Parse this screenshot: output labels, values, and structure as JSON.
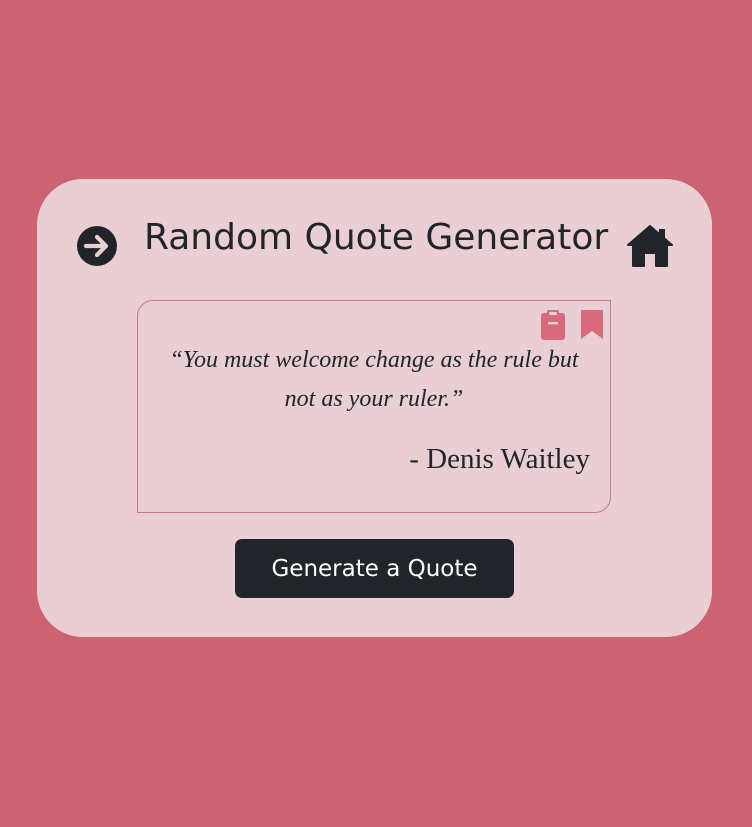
{
  "header": {
    "title": "Random Quote Generator",
    "left_icon": "arrow-right-circle-icon",
    "right_icon": "home-icon"
  },
  "quote": {
    "text": "“You must welcome change as the rule but not as your ruler.”",
    "author": "- Denis Waitley",
    "copy_icon": "clipboard-icon",
    "save_icon": "bookmark-icon"
  },
  "actions": {
    "generate_label": "Generate a Quote"
  },
  "colors": {
    "background": "#cd6372",
    "card": "#e9cfd3",
    "accent": "#d96a7b",
    "dark": "#212529"
  }
}
